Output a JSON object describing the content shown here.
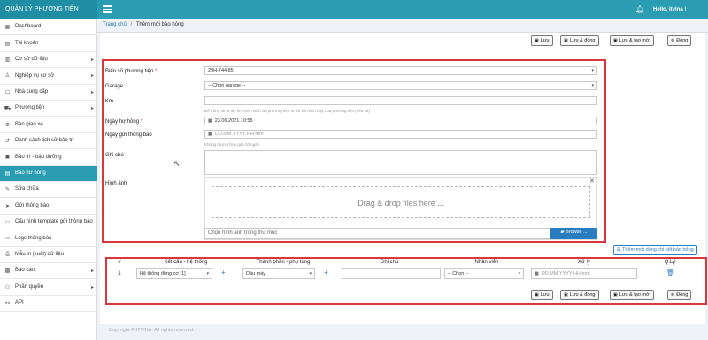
{
  "app": {
    "brand": "QUẢN LÝ PHƯƠNG TIỆN",
    "greeting": "Hello, itvina !"
  },
  "sidebar": {
    "items": [
      {
        "label": "Dashboard",
        "icon": "dashboard-icon",
        "glyph": "▦",
        "chevron": false,
        "active": false
      },
      {
        "label": "Tài khoản",
        "icon": "user-card-icon",
        "glyph": "▤",
        "chevron": false,
        "active": false
      },
      {
        "label": "Cơ sở dữ liệu",
        "icon": "database-icon",
        "glyph": "▥",
        "chevron": true,
        "active": false
      },
      {
        "label": "Nghiệp vụ cơ sở",
        "icon": "user-icon",
        "glyph": "♙",
        "chevron": true,
        "active": false
      },
      {
        "label": "Nhà cung cấp",
        "icon": "supplier-icon",
        "glyph": "☖",
        "chevron": true,
        "active": false
      },
      {
        "label": "Phương tiện",
        "icon": "truck-icon",
        "glyph": "⛟",
        "chevron": true,
        "active": false
      },
      {
        "label": "Bàn giao xe",
        "icon": "handover-icon",
        "glyph": "⚙",
        "chevron": false,
        "active": false
      },
      {
        "label": "Danh sách lịch sử bảo trì",
        "icon": "history-icon",
        "glyph": "↺",
        "chevron": false,
        "active": false
      },
      {
        "label": "Bảo trì - bảo dưỡng",
        "icon": "maintenance-icon",
        "glyph": "▣",
        "chevron": false,
        "active": false
      },
      {
        "label": "Báo hư hỏng",
        "icon": "report-damage-icon",
        "glyph": "▤",
        "chevron": false,
        "active": true
      },
      {
        "label": "Sửa chữa",
        "icon": "wrench-icon",
        "glyph": "✎",
        "chevron": false,
        "active": false
      },
      {
        "label": "Gửi thông báo",
        "icon": "send-icon",
        "glyph": "➤",
        "chevron": false,
        "active": false
      },
      {
        "label": "Cấu hình template gửi thông báo",
        "icon": "template-icon",
        "glyph": "▭",
        "chevron": false,
        "active": false
      },
      {
        "label": "Logs thông báo",
        "icon": "logs-icon",
        "glyph": "▭",
        "chevron": false,
        "active": false
      },
      {
        "label": "Mẫu in (xuất) dữ liệu",
        "icon": "print-icon",
        "glyph": "⎙",
        "chevron": false,
        "active": false
      },
      {
        "label": "Báo cáo",
        "icon": "chart-icon",
        "glyph": "▩",
        "chevron": true,
        "active": false
      },
      {
        "label": "Phân quyền",
        "icon": "permission-icon",
        "glyph": "⚇",
        "chevron": true,
        "active": false
      },
      {
        "label": "API",
        "icon": "api-icon",
        "glyph": "⚯",
        "chevron": false,
        "active": false
      }
    ]
  },
  "breadcrumb": {
    "home": "Trang chủ",
    "separator": "/",
    "current": "Thêm mới báo hỏng"
  },
  "toolbar": {
    "save": "Lưu",
    "save_close": "Lưu & đóng",
    "save_new": "Lưu & tạo mới",
    "close": "Đóng"
  },
  "form": {
    "vehicle_label": "Biển số phương tiện",
    "vehicle_required": "*",
    "vehicle_value": "29H-744.85",
    "garage_label": "Garage",
    "garage_value": "-- Chọn garage --",
    "km_label": "Km",
    "km_hint": "Để trống sẽ tự lấy km mới nhất của phương tiện từ dữ liệu km chạy của phương tiện (nếu có)",
    "damage_date_label": "Ngày hư hỏng",
    "damage_date_required": "*",
    "damage_date_value": "23.06.2021 10:55",
    "notify_date_label": "Ngày gửi thông báo",
    "notify_date_placeholder": "DD.MM.YYYY HH:mm",
    "notify_date_hint": "Không được chọn quá 30 ngày",
    "note_label": "Ghi chú",
    "image_label": "Hình ảnh",
    "dropzone_text": "Drag & drop files here ...",
    "file_placeholder": "Chọn hình ảnh trong thư mục",
    "browse_label": "Browse ..."
  },
  "detail": {
    "add_button": "Thêm mới dòng chi tiết báo hỏng",
    "headers": [
      "#",
      "Kết cấu - hệ thống",
      "Thành phần - phụ tùng",
      "Ghi chú",
      "Nhân viên",
      "Xử lý",
      "Q.Lý"
    ],
    "row": {
      "index": "1",
      "system": "Hệ thống động cơ [1]",
      "component": "Dầu máy",
      "staff": "-- Chọn --",
      "date_placeholder": "DD.MM.YYYY HH:mm"
    }
  },
  "footer": "Copyright © ITVINA. All rights reserved."
}
